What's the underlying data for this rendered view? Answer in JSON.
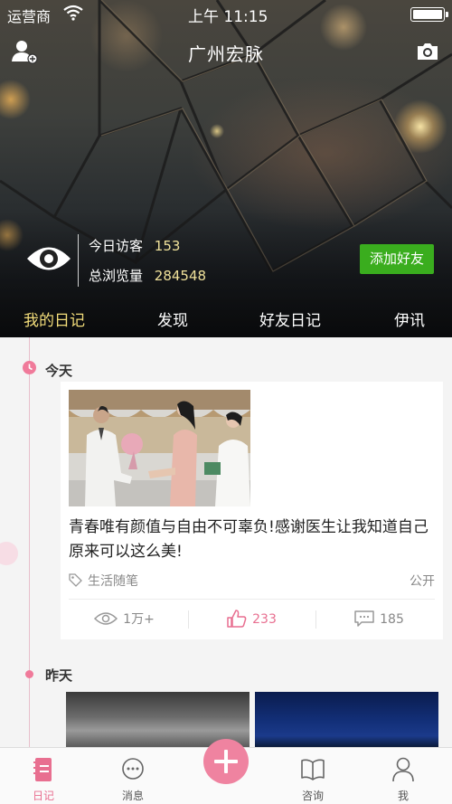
{
  "status_bar": {
    "carrier": "运营商",
    "time": "上午 11:15"
  },
  "header": {
    "title": "广州宏脉"
  },
  "visitors": {
    "today_label": "今日访客",
    "today_count": "153",
    "total_label": "总浏览量",
    "total_count": "284548",
    "add_friend": "添加好友"
  },
  "tabs": [
    {
      "label": "我的日记",
      "active": true
    },
    {
      "label": "发现",
      "active": false
    },
    {
      "label": "好友日记",
      "active": false
    },
    {
      "label": "伊讯",
      "active": false
    }
  ],
  "feed": {
    "today_label": "今天",
    "yesterday_label": "昨天",
    "post": {
      "text": "青春唯有颜值与自由不可辜负!感谢医生让我知道自己原来可以这么美!",
      "category": "生活随笔",
      "privacy": "公开",
      "views": "1万+",
      "likes": "233",
      "comments": "185"
    }
  },
  "bottom_nav": [
    {
      "label": "日记",
      "icon": "diary-icon",
      "active": true
    },
    {
      "label": "消息",
      "icon": "message-icon",
      "active": false
    },
    {
      "label": "咨询",
      "icon": "book-icon",
      "active": false
    },
    {
      "label": "我",
      "icon": "person-icon",
      "active": false
    }
  ],
  "colors": {
    "accent_pink": "#e86f90",
    "tab_active": "#f3dd7a",
    "add_friend_green": "#3aad1e",
    "count_yellow": "#f0e19a"
  }
}
